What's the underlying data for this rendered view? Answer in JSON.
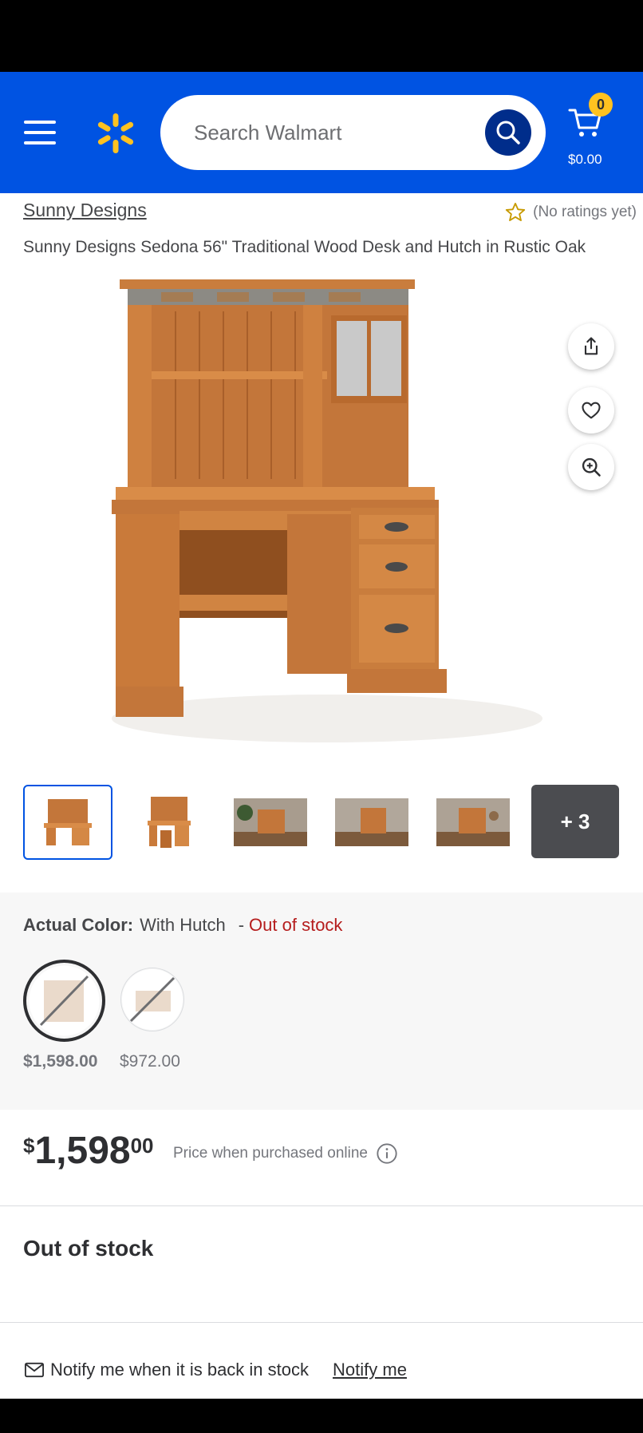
{
  "header": {
    "search_placeholder": "Search Walmart",
    "cart_count": "0",
    "cart_total": "$0.00",
    "brand_color": "#0053e2",
    "spark_color": "#ffc220"
  },
  "product": {
    "brand": "Sunny Designs",
    "rating_text": "(No ratings yet)",
    "title": "Sunny Designs Sedona 56\" Traditional Wood Desk and Hutch in Rustic Oak",
    "more_images_label": "+ 3"
  },
  "variant": {
    "label": "Actual Color:",
    "value": "With Hutch",
    "dash": "-",
    "stock_status": "Out of stock",
    "options": [
      {
        "price": "$1,598.00",
        "selected": true
      },
      {
        "price": "$972.00",
        "selected": false
      }
    ]
  },
  "price": {
    "currency": "$",
    "dollars": "1,598",
    "cents": "00",
    "note": "Price when purchased online"
  },
  "availability": {
    "heading": "Out of stock",
    "notify_text": "Notify me when it is back in stock",
    "notify_link": "Notify me"
  },
  "icons": [
    "menu-icon",
    "walmart-spark-icon",
    "search-icon",
    "cart-icon",
    "star-outline-icon",
    "share-icon",
    "heart-icon",
    "zoom-in-icon",
    "info-icon",
    "mail-icon"
  ]
}
